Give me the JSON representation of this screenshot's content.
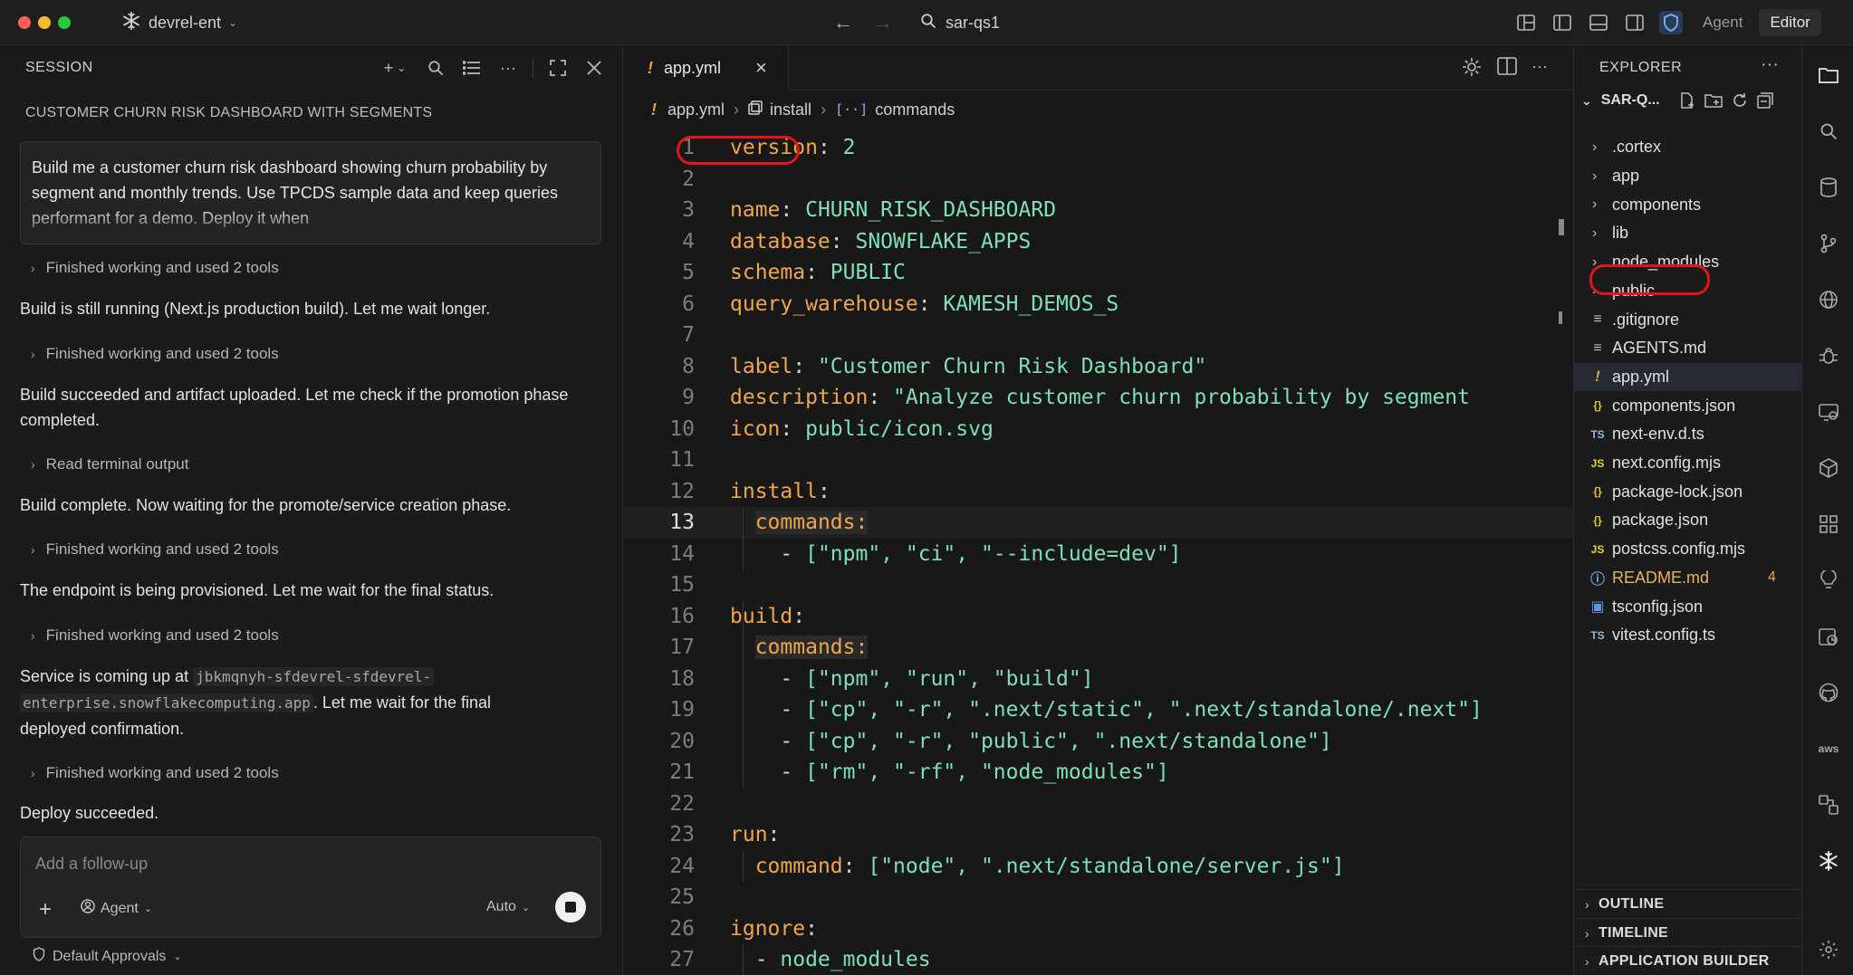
{
  "titlebar": {
    "workspace": "devrel-ent",
    "search_text": "sar-qs1",
    "mode_agent": "Agent",
    "mode_editor": "Editor"
  },
  "session": {
    "header": "SESSION",
    "title": "CUSTOMER CHURN RISK DASHBOARD WITH SEGMENTS",
    "prompt": "Build me a customer churn risk dashboard showing churn probability by segment and monthly trends. Use TPCDS sample data and keep queries performant for a demo. Deploy it when",
    "tool_rows": [
      "Finished working and used 2 tools",
      "Finished working and used 2 tools",
      "Read terminal output",
      "Finished working and used 2 tools",
      "Finished working and used 2 tools",
      "Finished working and used 2 tools"
    ],
    "messages": [
      "Build is still running (Next.js production build). Let me wait longer.",
      "Build succeeded and artifact uploaded. Let me check if the promotion phase completed.",
      "Build complete. Now waiting for the promote/service creation phase.",
      "The endpoint is being provisioned. Let me wait for the final status."
    ],
    "service_msg_prefix": "Service is coming up at ",
    "service_url_1": "jbkmqnyh-sfdevrel-sfdevrel-",
    "service_url_2": "enterprise.snowflakecomputing.app",
    "service_msg_suffix": ". Let me wait for the final",
    "service_msg_line3": "deployed confirmation.",
    "final_msg": "Deploy succeeded.",
    "followup_placeholder": "Add a follow-up",
    "agent_label": "Agent",
    "auto_label": "Auto",
    "approvals_label": "Default Approvals"
  },
  "editor": {
    "tab_label": "app.yml",
    "breadcrumb": [
      "app.yml",
      "install",
      "commands"
    ],
    "current_line": 13,
    "lines": [
      {
        "n": "1",
        "c": [
          [
            "k",
            "version"
          ],
          [
            "p",
            ": "
          ],
          [
            "v",
            "2"
          ]
        ]
      },
      {
        "n": "2",
        "c": []
      },
      {
        "n": "3",
        "c": [
          [
            "k",
            "name"
          ],
          [
            "p",
            ": "
          ],
          [
            "v",
            "CHURN_RISK_DASHBOARD"
          ]
        ]
      },
      {
        "n": "4",
        "c": [
          [
            "k",
            "database"
          ],
          [
            "p",
            ": "
          ],
          [
            "v",
            "SNOWFLAKE_APPS"
          ]
        ]
      },
      {
        "n": "5",
        "c": [
          [
            "k",
            "schema"
          ],
          [
            "p",
            ": "
          ],
          [
            "v",
            "PUBLIC"
          ]
        ]
      },
      {
        "n": "6",
        "c": [
          [
            "k",
            "query_warehouse"
          ],
          [
            "p",
            ": "
          ],
          [
            "v",
            "KAMESH_DEMOS_S"
          ]
        ]
      },
      {
        "n": "7",
        "c": []
      },
      {
        "n": "8",
        "c": [
          [
            "k",
            "label"
          ],
          [
            "p",
            ": "
          ],
          [
            "v",
            "\"Customer Churn Risk Dashboard\""
          ]
        ]
      },
      {
        "n": "9",
        "c": [
          [
            "k",
            "description"
          ],
          [
            "p",
            ": "
          ],
          [
            "v",
            "\"Analyze customer churn probability by segment"
          ]
        ]
      },
      {
        "n": "10",
        "c": [
          [
            "k",
            "icon"
          ],
          [
            "p",
            ": "
          ],
          [
            "v",
            "public/icon.svg"
          ]
        ]
      },
      {
        "n": "11",
        "c": []
      },
      {
        "n": "12",
        "c": [
          [
            "k",
            "install"
          ],
          [
            "p",
            ":"
          ]
        ]
      },
      {
        "n": "13",
        "c": [
          [
            "p",
            "  "
          ],
          [
            "kh",
            "commands:"
          ]
        ]
      },
      {
        "n": "14",
        "c": [
          [
            "p",
            "    - "
          ],
          [
            "v",
            "[\"npm\", \"ci\", \"--include=dev\"]"
          ]
        ]
      },
      {
        "n": "15",
        "c": []
      },
      {
        "n": "16",
        "c": [
          [
            "k",
            "build"
          ],
          [
            "p",
            ":"
          ]
        ]
      },
      {
        "n": "17",
        "c": [
          [
            "p",
            "  "
          ],
          [
            "kh",
            "commands:"
          ]
        ]
      },
      {
        "n": "18",
        "c": [
          [
            "p",
            "    - "
          ],
          [
            "v",
            "[\"npm\", \"run\", \"build\"]"
          ]
        ]
      },
      {
        "n": "19",
        "c": [
          [
            "p",
            "    - "
          ],
          [
            "v",
            "[\"cp\", \"-r\", \".next/static\", \".next/standalone/.next\"]"
          ]
        ]
      },
      {
        "n": "20",
        "c": [
          [
            "p",
            "    - "
          ],
          [
            "v",
            "[\"cp\", \"-r\", \"public\", \".next/standalone\"]"
          ]
        ]
      },
      {
        "n": "21",
        "c": [
          [
            "p",
            "    - "
          ],
          [
            "v",
            "[\"rm\", \"-rf\", \"node_modules\"]"
          ]
        ]
      },
      {
        "n": "22",
        "c": []
      },
      {
        "n": "23",
        "c": [
          [
            "k",
            "run"
          ],
          [
            "p",
            ":"
          ]
        ]
      },
      {
        "n": "24",
        "c": [
          [
            "p",
            "  "
          ],
          [
            "k",
            "command"
          ],
          [
            "p",
            ": "
          ],
          [
            "v",
            "[\"node\", \".next/standalone/server.js\"]"
          ]
        ]
      },
      {
        "n": "25",
        "c": []
      },
      {
        "n": "26",
        "c": [
          [
            "k",
            "ignore"
          ],
          [
            "p",
            ":"
          ]
        ]
      },
      {
        "n": "27",
        "c": [
          [
            "p",
            "  - "
          ],
          [
            "v",
            "node_modules"
          ]
        ]
      }
    ]
  },
  "explorer": {
    "header": "EXPLORER",
    "root": "SAR-Q...",
    "items": [
      {
        "name": ".cortex",
        "type": "folder"
      },
      {
        "name": "app",
        "type": "folder"
      },
      {
        "name": "components",
        "type": "folder"
      },
      {
        "name": "lib",
        "type": "folder"
      },
      {
        "name": "node_modules",
        "type": "folder"
      },
      {
        "name": "public",
        "type": "folder"
      },
      {
        "name": ".gitignore",
        "type": "lines",
        "icon": "≡",
        "color": "#bdbdbd"
      },
      {
        "name": "AGENTS.md",
        "type": "lines",
        "icon": "≡",
        "color": "#bdbdbd"
      },
      {
        "name": "app.yml",
        "type": "yaml",
        "icon": "!",
        "color": "#e8a33d"
      },
      {
        "name": "components.json",
        "type": "json",
        "icon": "{}",
        "color": "#e8c33d"
      },
      {
        "name": "next-env.d.ts",
        "type": "ts",
        "icon": "TS",
        "color": "#8fb7e0"
      },
      {
        "name": "next.config.mjs",
        "type": "js",
        "icon": "JS",
        "color": "#e8d33d"
      },
      {
        "name": "package-lock.json",
        "type": "json",
        "icon": "{}",
        "color": "#e8c33d"
      },
      {
        "name": "package.json",
        "type": "json",
        "icon": "{}",
        "color": "#e8c33d"
      },
      {
        "name": "postcss.config.mjs",
        "type": "js",
        "icon": "JS",
        "color": "#e8d33d"
      },
      {
        "name": "README.md",
        "type": "info",
        "icon": "ⓘ",
        "color": "#6fa3e0",
        "badge": "4",
        "name_color": "#e8b45a"
      },
      {
        "name": "tsconfig.json",
        "type": "tsconfig",
        "icon": "▣",
        "color": "#5a9be0"
      },
      {
        "name": "vitest.config.ts",
        "type": "ts",
        "icon": "TS",
        "color": "#8fb7e0"
      }
    ],
    "sections": [
      "OUTLINE",
      "TIMELINE",
      "APPLICATION BUILDER"
    ]
  },
  "colors": {
    "accent": "#e0161b",
    "yaml_key": "#f0a64a",
    "yaml_value": "#7ee0b4"
  }
}
